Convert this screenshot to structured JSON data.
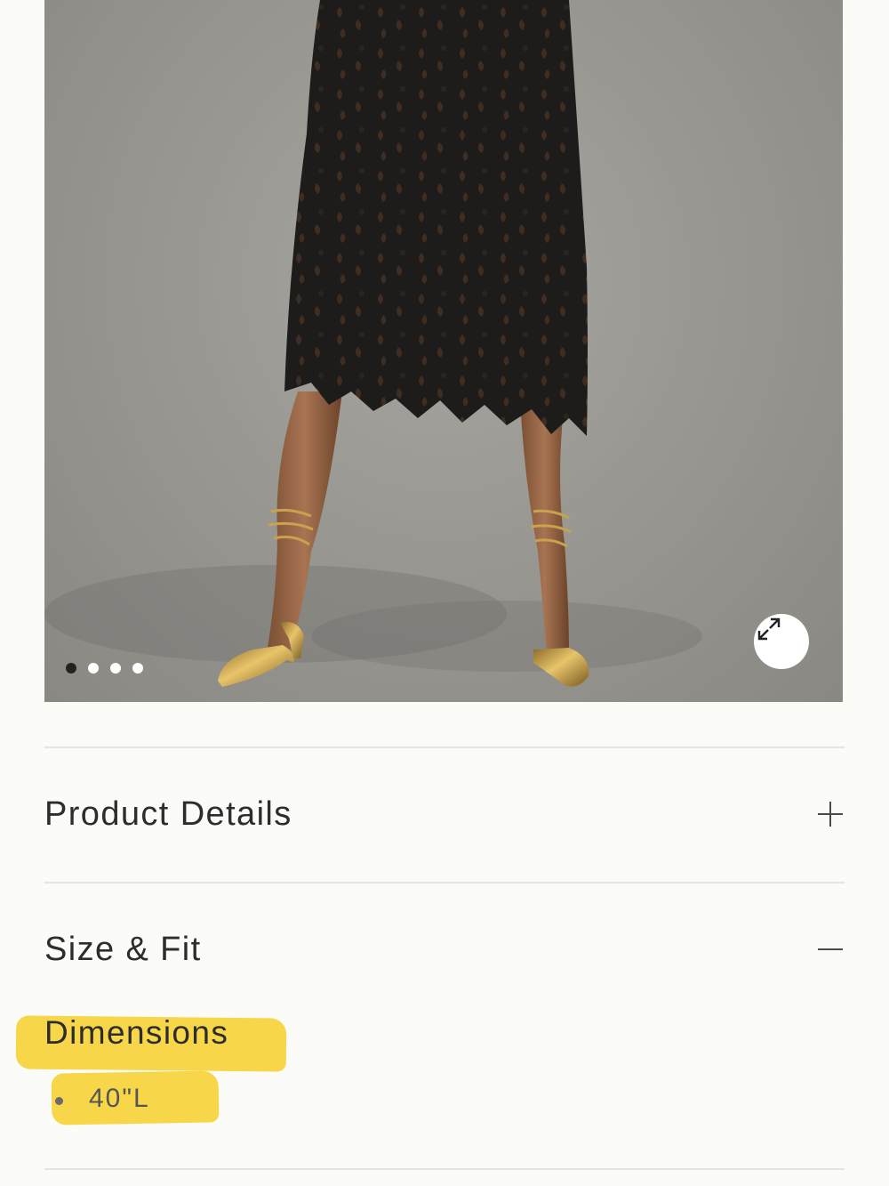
{
  "product_image": {
    "carousel": {
      "total": 4,
      "active_index": 0
    },
    "expand_icon": "expand-arrows-icon"
  },
  "accordion": [
    {
      "title": "Product Details",
      "state": "collapsed",
      "icon": "plus-icon"
    },
    {
      "title": "Size & Fit",
      "state": "expanded",
      "icon": "minus-icon"
    }
  ],
  "size_fit": {
    "dimensions_heading": "Dimensions",
    "dimensions": [
      "40\"L"
    ]
  },
  "colors": {
    "highlight": "#f7d23a",
    "background": "#fbfbf8",
    "divider": "#e4e4e0"
  }
}
